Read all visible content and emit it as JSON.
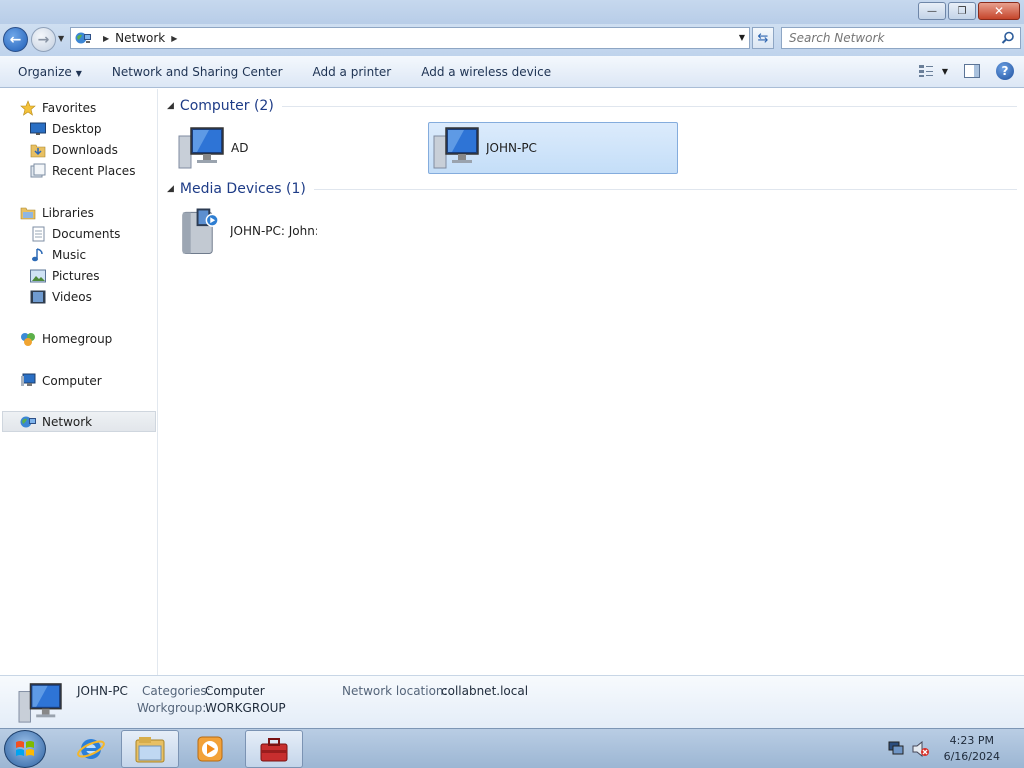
{
  "window": {
    "minimize_glyph": "—",
    "maximize_glyph": "❐",
    "close_glyph": "✕"
  },
  "address": {
    "location": "Network",
    "search_placeholder": "Search Network"
  },
  "commands": {
    "organize": "Organize",
    "network_sharing": "Network and Sharing Center",
    "add_printer": "Add a printer",
    "add_wireless": "Add a wireless device"
  },
  "sidebar": {
    "favorites": "Favorites",
    "desktop": "Desktop",
    "downloads": "Downloads",
    "recent_places": "Recent Places",
    "libraries": "Libraries",
    "documents": "Documents",
    "music": "Music",
    "pictures": "Pictures",
    "videos": "Videos",
    "homegroup": "Homegroup",
    "computer": "Computer",
    "network": "Network"
  },
  "groups": {
    "computer_header": "Computer (2)",
    "media_header": "Media Devices (1)",
    "computers": [
      "AD",
      "JOHN-PC"
    ],
    "media": [
      "JOHN-PC: John:"
    ]
  },
  "details": {
    "name": "JOHN-PC",
    "categories_label": "Categories:",
    "categories_value": "Computer",
    "workgroup_label": "Workgroup:",
    "workgroup_value": "WORKGROUP",
    "netloc_label": "Network location:",
    "netloc_value": "collabnet.local"
  },
  "taskbar": {
    "time": "4:23 PM",
    "date": "6/16/2024"
  },
  "colors": {
    "accent": "#1e3c87",
    "selection": "#c4def8"
  },
  "icons": [
    "back-arrow-icon",
    "forward-arrow-icon",
    "network-icon",
    "search-icon",
    "refresh-icon",
    "help-icon",
    "star-icon",
    "folder-icon",
    "computer-icon",
    "media-device-icon",
    "windows-logo-icon",
    "ie-icon",
    "explorer-icon",
    "media-player-icon",
    "toolbox-icon",
    "volume-muted-icon"
  ]
}
